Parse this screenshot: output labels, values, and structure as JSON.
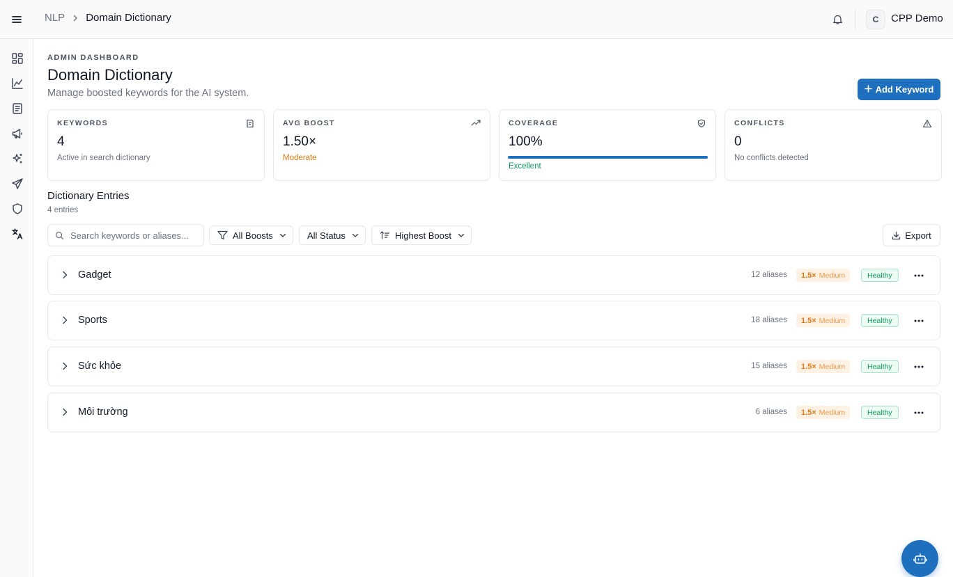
{
  "breadcrumb": {
    "parent": "NLP",
    "current": "Domain Dictionary"
  },
  "user": {
    "avatar_initial": "C",
    "name": "CPP Demo"
  },
  "sidebar": {
    "items": [
      "dashboard-icon",
      "analytics-icon",
      "document-icon",
      "megaphone-icon",
      "sparkles-icon",
      "send-icon",
      "shield-icon",
      "translate-icon"
    ]
  },
  "header": {
    "eyebrow": "ADMIN DASHBOARD",
    "title": "Domain Dictionary",
    "subtitle": "Manage boosted keywords for the AI system.",
    "add_button": "Add Keyword"
  },
  "stats": {
    "keywords": {
      "label": "KEYWORDS",
      "value": "4",
      "note": "Active in search dictionary"
    },
    "avg_boost": {
      "label": "AVG BOOST",
      "value": "1.50×",
      "note": "Moderate"
    },
    "coverage": {
      "label": "COVERAGE",
      "value": "100%",
      "note": "Excellent",
      "progress": 1.0
    },
    "conflicts": {
      "label": "CONFLICTS",
      "value": "0",
      "note": "No conflicts detected"
    }
  },
  "entries_section": {
    "title": "Dictionary Entries",
    "count": "4 entries"
  },
  "toolbar": {
    "search_placeholder": "Search keywords or aliases...",
    "boost_filter": "All Boosts",
    "status_filter": "All Status",
    "sort": "Highest Boost",
    "export": "Export"
  },
  "entries": [
    {
      "name": "Gadget",
      "aliases": "12 aliases",
      "boost": "1.5×",
      "boost_level": "Medium",
      "status": "Healthy"
    },
    {
      "name": "Sports",
      "aliases": "18 aliases",
      "boost": "1.5×",
      "boost_level": "Medium",
      "status": "Healthy"
    },
    {
      "name": "Sức khỏe",
      "aliases": "15 aliases",
      "boost": "1.5×",
      "boost_level": "Medium",
      "status": "Healthy"
    },
    {
      "name": "Môi trường",
      "aliases": "6 aliases",
      "boost": "1.5×",
      "boost_level": "Medium",
      "status": "Healthy"
    }
  ],
  "colors": {
    "accent": "#1f6fbf",
    "boost": "#e07b16",
    "healthy": "#0f9d58"
  }
}
